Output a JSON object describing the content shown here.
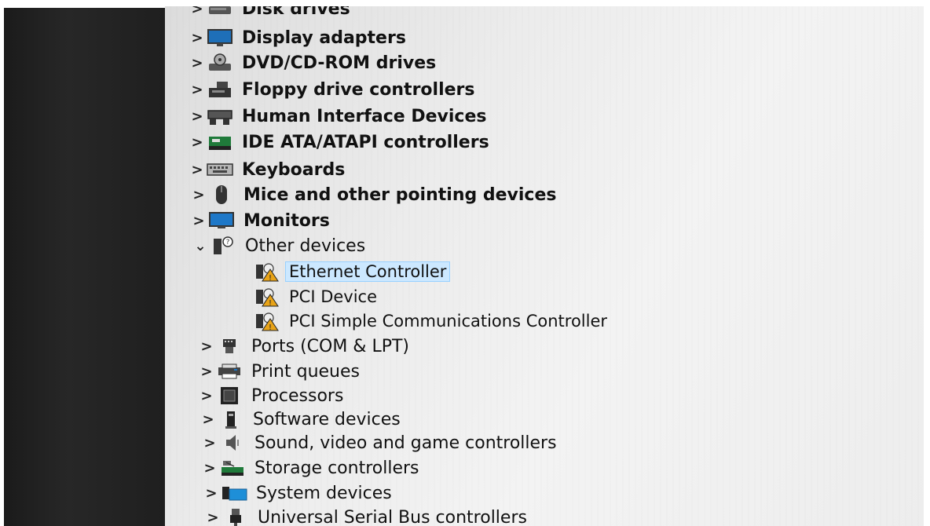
{
  "device_manager": {
    "categories": [
      {
        "label": "Disk drives",
        "icon": "disk-drive-icon",
        "expanded": false
      },
      {
        "label": "Display adapters",
        "icon": "display-adapter-icon",
        "expanded": false
      },
      {
        "label": "DVD/CD-ROM drives",
        "icon": "dvd-drive-icon",
        "expanded": false
      },
      {
        "label": "Floppy drive controllers",
        "icon": "floppy-controller-icon",
        "expanded": false
      },
      {
        "label": "Human Interface Devices",
        "icon": "hid-icon",
        "expanded": false
      },
      {
        "label": "IDE ATA/ATAPI controllers",
        "icon": "ide-controller-icon",
        "expanded": false
      },
      {
        "label": "Keyboards",
        "icon": "keyboard-icon",
        "expanded": false
      },
      {
        "label": "Mice and other pointing devices",
        "icon": "mouse-icon",
        "expanded": false
      },
      {
        "label": "Monitors",
        "icon": "monitor-icon",
        "expanded": false
      },
      {
        "label": "Other devices",
        "icon": "unknown-device-icon",
        "expanded": true,
        "children": [
          {
            "label": "Ethernet Controller",
            "icon": "warning-device-icon",
            "selected": true
          },
          {
            "label": "PCI Device",
            "icon": "warning-device-icon",
            "selected": false
          },
          {
            "label": "PCI Simple Communications Controller",
            "icon": "warning-device-icon",
            "selected": false
          }
        ]
      },
      {
        "label": "Ports (COM & LPT)",
        "icon": "port-icon",
        "expanded": false
      },
      {
        "label": "Print queues",
        "icon": "printer-icon",
        "expanded": false
      },
      {
        "label": "Processors",
        "icon": "processor-icon",
        "expanded": false
      },
      {
        "label": "Software devices",
        "icon": "software-device-icon",
        "expanded": false
      },
      {
        "label": "Sound, video and game controllers",
        "icon": "speaker-icon",
        "expanded": false
      },
      {
        "label": "Storage controllers",
        "icon": "storage-controller-icon",
        "expanded": false
      },
      {
        "label": "System devices",
        "icon": "system-device-icon",
        "expanded": false
      },
      {
        "label": "Universal Serial Bus controllers",
        "icon": "usb-icon",
        "expanded": false
      }
    ],
    "chevron_collapsed": ">",
    "chevron_expanded": "⌄",
    "colors": {
      "selection": "#cce8ff",
      "selection_border": "#99d1ff",
      "warning": "#e8a317"
    }
  }
}
